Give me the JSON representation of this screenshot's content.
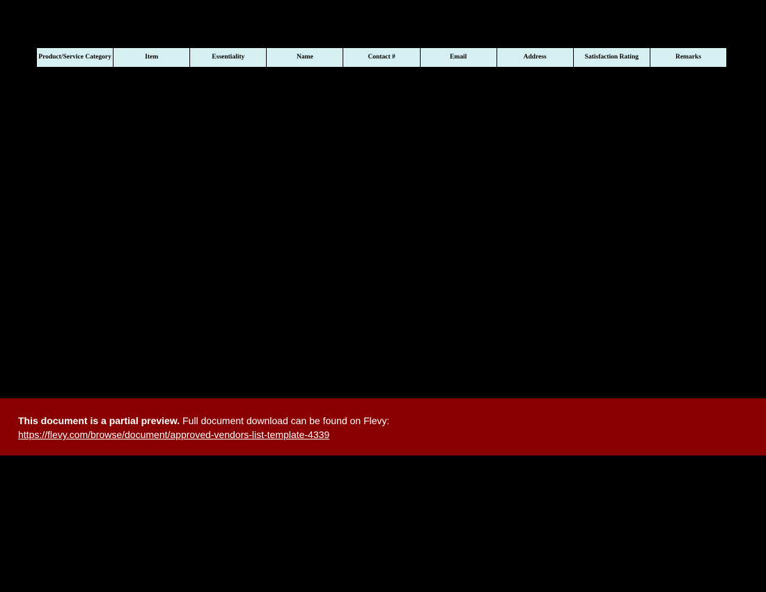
{
  "table": {
    "columns": [
      "Product/Service Category",
      "Item",
      "Essentiality",
      "Name",
      "Contact #",
      "Email",
      "Address",
      "Satisfaction Rating",
      "Remarks"
    ]
  },
  "notice": {
    "bold": "This document is a partial preview.",
    "rest": "  Full document download can be found on Flevy:",
    "link_text": "https://flevy.com/browse/document/approved-vendors-list-template-4339"
  }
}
